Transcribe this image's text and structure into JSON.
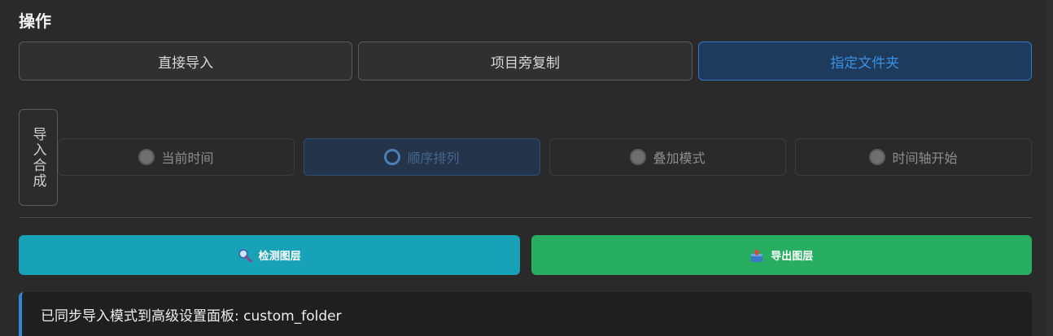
{
  "section": {
    "title": "操作"
  },
  "import_modes": [
    {
      "label": "直接导入",
      "active": false
    },
    {
      "label": "项目旁复制",
      "active": false
    },
    {
      "label": "指定文件夹",
      "active": true
    }
  ],
  "composition": {
    "label": "导入合成",
    "options": [
      {
        "label": "当前时间",
        "selected": false
      },
      {
        "label": "顺序排列",
        "selected": true
      },
      {
        "label": "叠加模式",
        "selected": false
      },
      {
        "label": "时间轴开始",
        "selected": false
      }
    ]
  },
  "actions": {
    "detect_label": "检测图层",
    "detect_icon": "magnifier-icon",
    "detect_color": "#17a2b8",
    "export_label": "导出图层",
    "export_icon": "export-box-icon",
    "export_color": "#27ae60"
  },
  "status": {
    "message": "已同步导入模式到高级设置面板: custom_folder"
  },
  "colors": {
    "accent": "#2f86d6",
    "background": "#2a2a2a"
  }
}
